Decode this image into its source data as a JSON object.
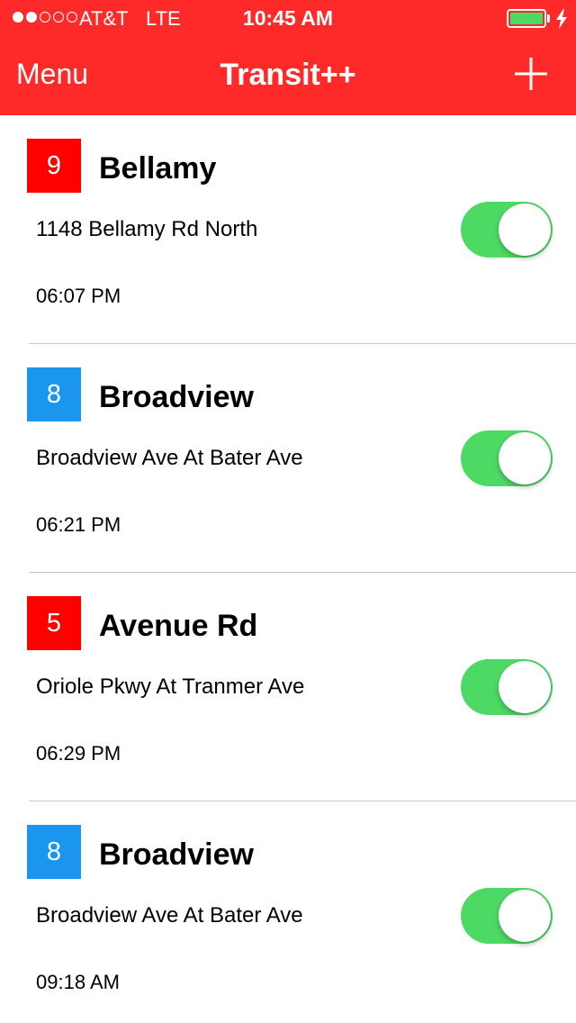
{
  "status_bar": {
    "carrier": "AT&T",
    "network": "LTE",
    "time": "10:45 AM",
    "signal_bars_filled": 2,
    "signal_bars_total": 5,
    "battery_color": "#4cd964"
  },
  "nav": {
    "menu_label": "Menu",
    "title": "Transit++",
    "add_icon": "plus-icon",
    "bar_color": "#fe2a2a"
  },
  "routes": [
    {
      "number": "9",
      "name": "Bellamy",
      "stop": "1148 Bellamy Rd North",
      "time": "06:07 PM",
      "badge_color": "#fe0000",
      "enabled": true
    },
    {
      "number": "8",
      "name": "Broadview",
      "stop": "Broadview Ave At Bater Ave",
      "time": "06:21 PM",
      "badge_color": "#1a96ef",
      "enabled": true
    },
    {
      "number": "5",
      "name": "Avenue Rd",
      "stop": "Oriole Pkwy At Tranmer Ave",
      "time": "06:29 PM",
      "badge_color": "#fe0000",
      "enabled": true
    },
    {
      "number": "8",
      "name": "Broadview",
      "stop": "Broadview Ave At Bater Ave",
      "time": "09:18 AM",
      "badge_color": "#1a96ef",
      "enabled": true
    }
  ]
}
